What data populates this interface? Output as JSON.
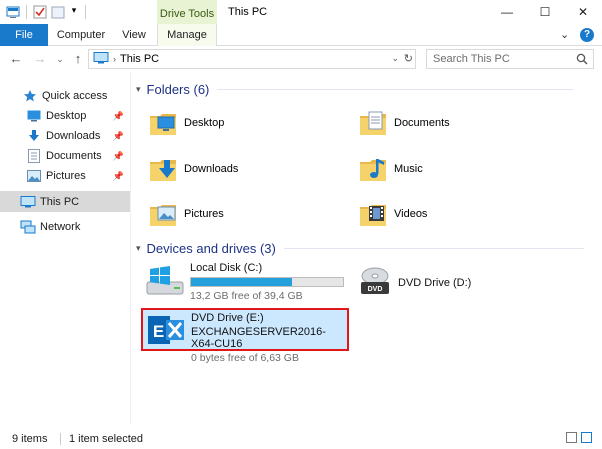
{
  "window": {
    "title": "This PC",
    "contextual_tab_group": "Drive Tools",
    "controls": {
      "minimize": "—",
      "maximize": "☐",
      "close": "✕"
    }
  },
  "ribbon": {
    "tabs": [
      {
        "label": "File"
      },
      {
        "label": "Computer"
      },
      {
        "label": "View"
      },
      {
        "label": "Manage"
      }
    ],
    "chevron": "⌄",
    "help": "?"
  },
  "address": {
    "back": "←",
    "forward": "→",
    "recent": "⌄",
    "up": "↑",
    "separator": "›",
    "crumb": "This PC",
    "dropdown": "⌄",
    "refresh": "↻",
    "search_placeholder": "Search This PC"
  },
  "sidebar": {
    "items": [
      {
        "label": "Quick access",
        "icon": "star-icon"
      },
      {
        "label": "Desktop",
        "icon": "desktop-icon",
        "pinned": "📌"
      },
      {
        "label": "Downloads",
        "icon": "downloads-icon",
        "pinned": "📌"
      },
      {
        "label": "Documents",
        "icon": "documents-icon",
        "pinned": "📌"
      },
      {
        "label": "Pictures",
        "icon": "pictures-icon",
        "pinned": "📌"
      },
      {
        "label": "This PC",
        "icon": "this-pc-icon"
      },
      {
        "label": "Network",
        "icon": "network-icon"
      }
    ]
  },
  "content": {
    "folders_header": "Folders (6)",
    "folders": [
      {
        "label": "Desktop",
        "icon": "desktop-folder-icon"
      },
      {
        "label": "Documents",
        "icon": "documents-folder-icon"
      },
      {
        "label": "Downloads",
        "icon": "downloads-folder-icon"
      },
      {
        "label": "Music",
        "icon": "music-folder-icon"
      },
      {
        "label": "Pictures",
        "icon": "pictures-folder-icon"
      },
      {
        "label": "Videos",
        "icon": "videos-folder-icon"
      }
    ],
    "drives_header": "Devices and drives (3)",
    "drives": [
      {
        "name": "Local Disk (C:)",
        "free": "13,2 GB free of 39,4 GB",
        "used_fraction": 0.665,
        "icon": "local-disk-icon"
      },
      {
        "name": "DVD Drive (D:)",
        "icon": "dvd-drive-icon",
        "badge": "DVD"
      },
      {
        "name": "DVD Drive (E:)",
        "volume": "EXCHANGESERVER2016-X64-CU16",
        "free": "0 bytes free of 6,63 GB",
        "icon": "exchange-icon",
        "badge": "E"
      }
    ]
  },
  "status": {
    "count": "9 items",
    "selection": "1 item selected"
  },
  "colors": {
    "accent": "#1979ca",
    "selection_bg": "#cce8ff",
    "highlight_border": "#e0161b",
    "group_header": "#1e3287",
    "exchange_blue": "#0a64b4"
  }
}
